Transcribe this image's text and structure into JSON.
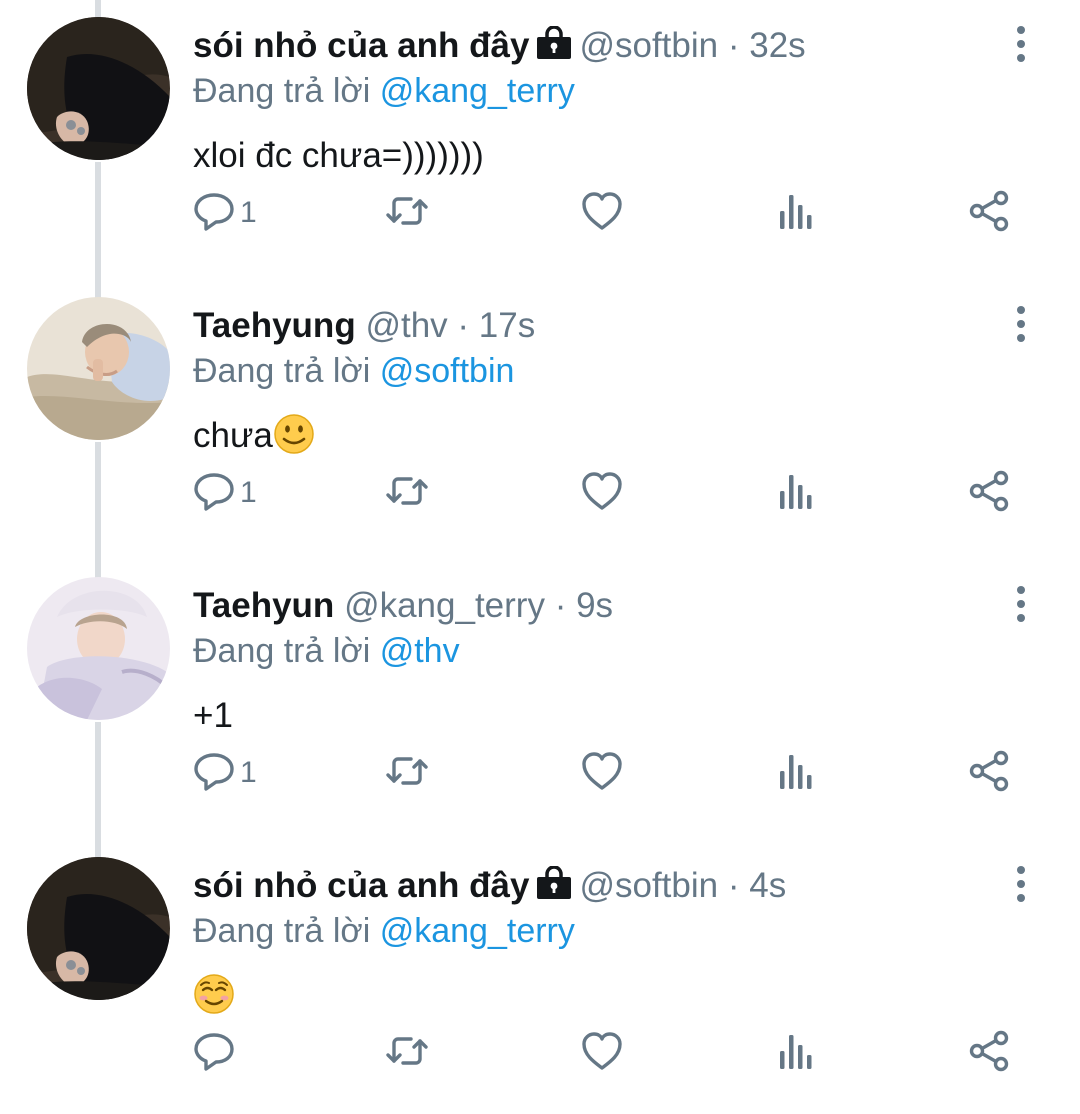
{
  "reply_prefix": "Đang trả lời",
  "colors": {
    "text": "#14171a",
    "muted": "#657786",
    "link": "#1b95e0",
    "thread_line": "#d9dde1"
  },
  "icons": {
    "reply": "reply-icon",
    "retweet": "retweet-icon",
    "like": "heart-icon",
    "stats": "analytics-icon",
    "share": "share-icon",
    "more": "more-vertical-icon",
    "lock": "lock-icon"
  },
  "tweets": [
    {
      "name": "sói nhỏ của anh đây",
      "protected": true,
      "handle": "@softbin",
      "dot": "·",
      "time": "32s",
      "reply_to": "@kang_terry",
      "text": "xloi đc chưa=)))))))",
      "emoji": "",
      "reply_count": "1",
      "avatar": "dark"
    },
    {
      "name": "Taehyung",
      "protected": false,
      "handle": "@thv",
      "dot": "·",
      "time": "17s",
      "reply_to": "@softbin",
      "text": "chưa",
      "emoji": "slightly-smiling-face",
      "reply_count": "1",
      "avatar": "light"
    },
    {
      "name": "Taehyun",
      "protected": false,
      "handle": "@kang_terry",
      "dot": "·",
      "time": "9s",
      "reply_to": "@thv",
      "text": "+1",
      "emoji": "",
      "reply_count": "1",
      "avatar": "lavender"
    },
    {
      "name": "sói nhỏ của anh đây",
      "protected": true,
      "handle": "@softbin",
      "dot": "·",
      "time": "4s",
      "reply_to": "@kang_terry",
      "text": "",
      "emoji": "smiling-face",
      "reply_count": "",
      "avatar": "dark"
    }
  ]
}
